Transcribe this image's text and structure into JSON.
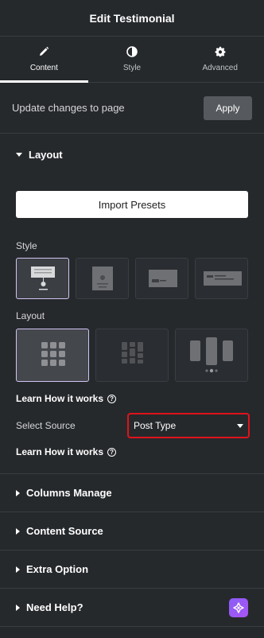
{
  "panel_title": "Edit Testimonial",
  "tabs": [
    {
      "label": "Content",
      "icon": "pencil-icon",
      "active": true
    },
    {
      "label": "Style",
      "icon": "half-circle-icon",
      "active": false
    },
    {
      "label": "Advanced",
      "icon": "gear-icon",
      "active": false
    }
  ],
  "update": {
    "text": "Update changes to page",
    "apply_label": "Apply"
  },
  "layout_section": {
    "title": "Layout",
    "import_label": "Import Presets",
    "style_label": "Style",
    "style_options": [
      "style-1",
      "style-2",
      "style-3",
      "style-4"
    ],
    "style_selected": 0,
    "layout_label": "Layout",
    "layout_options": [
      "grid",
      "masonry",
      "carousel"
    ],
    "layout_selected": 0,
    "learn_label": "Learn How it works",
    "source_label": "Select Source",
    "source_value": "Post Type",
    "learn_label_2": "Learn How it works"
  },
  "collapsed_sections": [
    {
      "title": "Columns Manage"
    },
    {
      "title": "Content Source"
    },
    {
      "title": "Extra Option"
    },
    {
      "title": "Need Help?"
    }
  ],
  "colors": {
    "accent_border": "#d1c4f4",
    "highlight_red": "#e0131b",
    "help_badge": "#9b5cf6"
  }
}
